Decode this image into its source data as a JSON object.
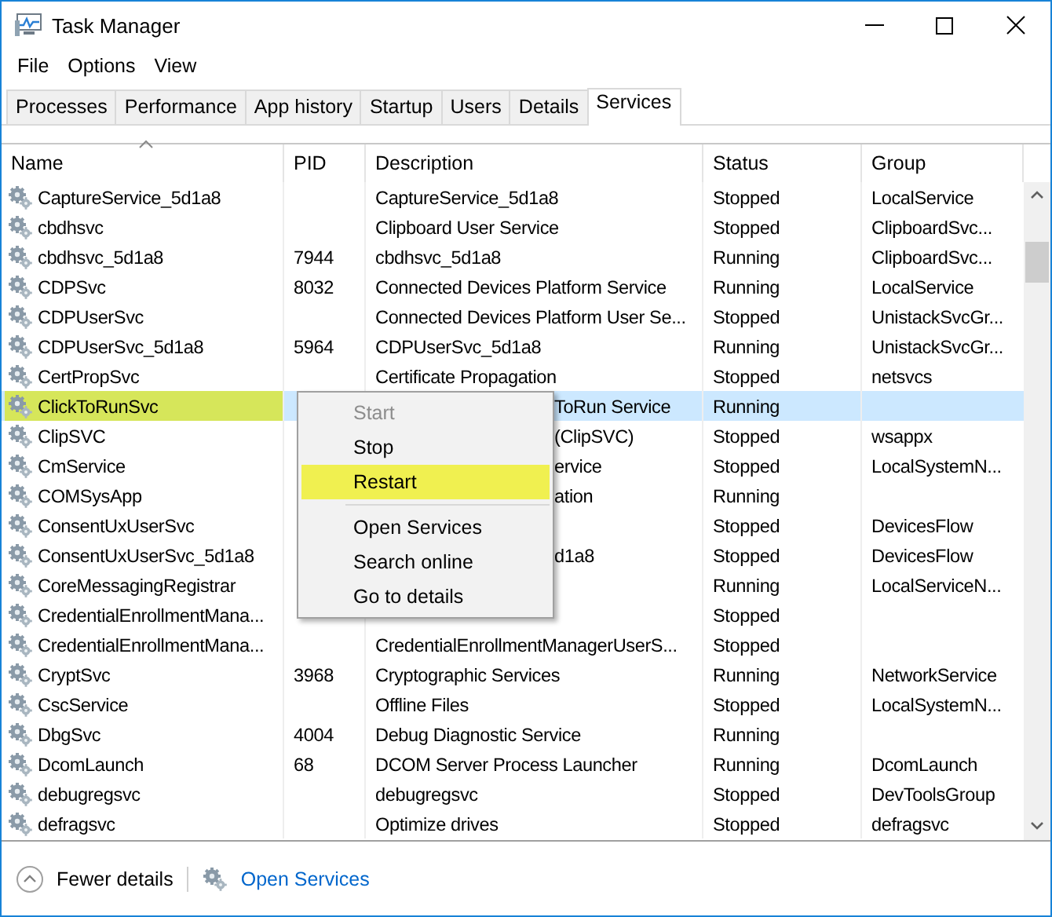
{
  "window": {
    "title": "Task Manager"
  },
  "menu_bar": [
    "File",
    "Options",
    "View"
  ],
  "tabs": [
    {
      "label": "Processes",
      "selected": false
    },
    {
      "label": "Performance",
      "selected": false
    },
    {
      "label": "App history",
      "selected": false
    },
    {
      "label": "Startup",
      "selected": false
    },
    {
      "label": "Users",
      "selected": false
    },
    {
      "label": "Details",
      "selected": false
    },
    {
      "label": "Services",
      "selected": true
    }
  ],
  "table": {
    "columns": [
      {
        "label": "Name",
        "sorted": true
      },
      {
        "label": "PID",
        "sorted": false
      },
      {
        "label": "Description",
        "sorted": false
      },
      {
        "label": "Status",
        "sorted": false
      },
      {
        "label": "Group",
        "sorted": false
      }
    ],
    "rows": [
      {
        "name": "CaptureService_5d1a8",
        "description": "CaptureService_5d1a8",
        "status": "Stopped",
        "group": "LocalService",
        "selected": false,
        "highlighted": false,
        "covered": false
      },
      {
        "name": "cbdhsvc",
        "description": "Clipboard User Service",
        "status": "Stopped",
        "group": "ClipboardSvc...",
        "selected": false,
        "highlighted": false,
        "covered": false
      },
      {
        "name": "cbdhsvc_5d1a8",
        "pid": "7944",
        "description": "cbdhsvc_5d1a8",
        "status": "Running",
        "group": "ClipboardSvc...",
        "selected": false,
        "highlighted": false,
        "covered": false
      },
      {
        "name": "CDPSvc",
        "pid": "8032",
        "description": "Connected Devices Platform Service",
        "status": "Running",
        "group": "LocalService",
        "selected": false,
        "highlighted": false,
        "covered": false
      },
      {
        "name": "CDPUserSvc",
        "description": "Connected Devices Platform User Se...",
        "status": "Stopped",
        "group": "UnistackSvcGr...",
        "selected": false,
        "highlighted": false,
        "covered": false
      },
      {
        "name": "CDPUserSvc_5d1a8",
        "pid": "5964",
        "description": "CDPUserSvc_5d1a8",
        "status": "Running",
        "group": "UnistackSvcGr...",
        "selected": false,
        "highlighted": false,
        "covered": false
      },
      {
        "name": "CertPropSvc",
        "description": "Certificate Propagation",
        "status": "Stopped",
        "group": "netsvcs",
        "selected": false,
        "highlighted": false,
        "covered": false
      },
      {
        "name": "ClickToRunSvc",
        "description": "ToRun Service",
        "status": "Running",
        "selected": true,
        "highlighted": true,
        "covered": true
      },
      {
        "name": "ClipSVC",
        "description": "(ClipSVC)",
        "status": "Stopped",
        "group": "wsappx",
        "selected": false,
        "highlighted": false,
        "covered": true
      },
      {
        "name": "CmService",
        "description": "ervice",
        "status": "Stopped",
        "group": "LocalSystemN...",
        "selected": false,
        "highlighted": false,
        "covered": true
      },
      {
        "name": "COMSysApp",
        "description": "ation",
        "status": "Running",
        "selected": false,
        "highlighted": false,
        "covered": true
      },
      {
        "name": "ConsentUxUserSvc",
        "status": "Stopped",
        "group": "DevicesFlow",
        "selected": false,
        "highlighted": false
      },
      {
        "name": "ConsentUxUserSvc_5d1a8",
        "description": "d1a8",
        "status": "Stopped",
        "group": "DevicesFlow",
        "selected": false,
        "highlighted": false,
        "covered": true
      },
      {
        "name": "CoreMessagingRegistrar",
        "status": "Running",
        "group": "LocalServiceN...",
        "selected": false,
        "highlighted": false
      },
      {
        "name": "CredentialEnrollmentMana...",
        "status": "Stopped",
        "selected": false,
        "highlighted": false
      },
      {
        "name": "CredentialEnrollmentMana...",
        "description": "CredentialEnrollmentManagerUserS...",
        "status": "Stopped",
        "selected": false,
        "highlighted": false,
        "covered": false
      },
      {
        "name": "CryptSvc",
        "pid": "3968",
        "description": "Cryptographic Services",
        "status": "Running",
        "group": "NetworkService",
        "selected": false,
        "highlighted": false,
        "covered": false
      },
      {
        "name": "CscService",
        "description": "Offline Files",
        "status": "Stopped",
        "group": "LocalSystemN...",
        "selected": false,
        "highlighted": false,
        "covered": false
      },
      {
        "name": "DbgSvc",
        "pid": "4004",
        "description": "Debug Diagnostic Service",
        "status": "Running",
        "selected": false,
        "highlighted": false,
        "covered": false
      },
      {
        "name": "DcomLaunch",
        "pid": "68",
        "description": "DCOM Server Process Launcher",
        "status": "Running",
        "group": "DcomLaunch",
        "selected": false,
        "highlighted": false,
        "covered": false
      },
      {
        "name": "debugregsvc",
        "description": "debugregsvc",
        "status": "Stopped",
        "group": "DevToolsGroup",
        "selected": false,
        "highlighted": false,
        "covered": false
      },
      {
        "name": "defragsvc",
        "description": "Optimize drives",
        "status": "Stopped",
        "group": "defragsvc",
        "selected": false,
        "highlighted": false,
        "covered": false
      }
    ]
  },
  "context_menu": {
    "items": [
      {
        "kind": "item",
        "label": "Start",
        "disabled": true,
        "highlighted": false
      },
      {
        "kind": "item",
        "label": "Stop",
        "disabled": false,
        "highlighted": false
      },
      {
        "kind": "item",
        "label": "Restart",
        "disabled": false,
        "highlighted": true
      },
      {
        "kind": "separator"
      },
      {
        "kind": "item",
        "label": "Open Services",
        "disabled": false,
        "highlighted": false
      },
      {
        "kind": "item",
        "label": "Search online",
        "disabled": false,
        "highlighted": false
      },
      {
        "kind": "item",
        "label": "Go to details",
        "disabled": false,
        "highlighted": false
      }
    ]
  },
  "footer": {
    "fewer_details": "Fewer details",
    "open_services": "Open Services"
  }
}
